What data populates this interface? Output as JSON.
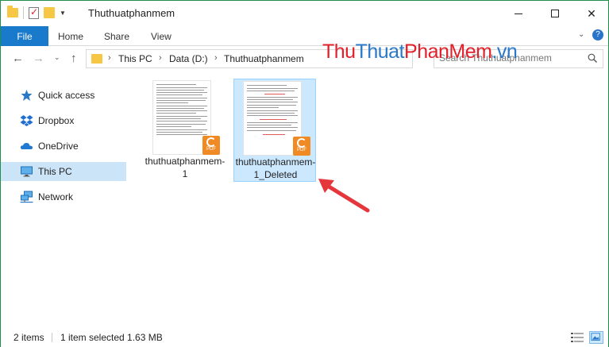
{
  "window": {
    "title": "Thuthuatphanmem",
    "minimize_label": "",
    "maximize_label": "",
    "close_label": "✕"
  },
  "ribbon": {
    "tabs": [
      {
        "label": "File"
      },
      {
        "label": "Home"
      },
      {
        "label": "Share"
      },
      {
        "label": "View"
      }
    ],
    "help_label": "?"
  },
  "address": {
    "crumbs": [
      "This PC",
      "Data (D:)",
      "Thuthuatphanmem"
    ]
  },
  "search": {
    "placeholder": "Search Thuthuatphanmem"
  },
  "watermark": {
    "part1": "Thu",
    "part2": "Thuat",
    "part3": "PhanMem",
    "part4": ".vn"
  },
  "nav_pane": {
    "items": [
      {
        "label": "Quick access",
        "icon": "star-icon"
      },
      {
        "label": "Dropbox",
        "icon": "dropbox-icon"
      },
      {
        "label": "OneDrive",
        "icon": "cloud-icon"
      },
      {
        "label": "This PC",
        "icon": "monitor-icon",
        "selected": true
      },
      {
        "label": "Network",
        "icon": "network-icon"
      }
    ]
  },
  "files": [
    {
      "name": "thuthuatphanmem-1",
      "type": "PDF",
      "selected": false
    },
    {
      "name": "thuthuatphanmem-1_Deleted",
      "type": "PDF",
      "selected": true
    }
  ],
  "status": {
    "count": "2 items",
    "selection": "1 item selected  1.63 MB"
  },
  "colors": {
    "accent": "#1979ca",
    "selection": "#cce8ff",
    "arrow": "#e5363c",
    "pdf_badge": "#f08a24"
  }
}
